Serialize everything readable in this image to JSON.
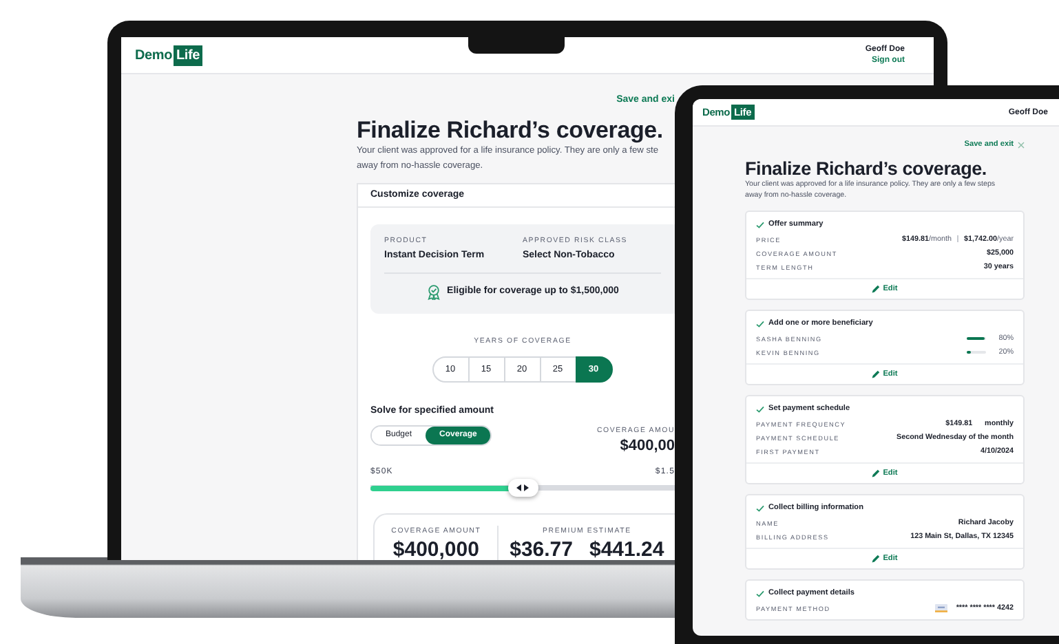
{
  "laptop": {
    "header": {
      "logo": {
        "word": "Demo",
        "badge": "Life"
      },
      "user": "Geoff Doe",
      "sign_out": "Sign out"
    },
    "save_exit": "Save and exi",
    "title": "Finalize Richard’s coverage.",
    "intro_lines": [
      "Your client was approved for a life insurance policy. They are only a few ste",
      "away from no-hassle coverage."
    ],
    "card_title": "Customize coverage",
    "facts": [
      {
        "label": "PRODUCT",
        "value": "Instant Decision Term"
      },
      {
        "label": "APPROVED RISK CLASS",
        "value": "Select Non-Tobacco"
      }
    ],
    "eligibility": "Eligible for coverage up to $1,500,000",
    "years_label": "YEARS OF COVERAGE",
    "years": [
      {
        "label": "10",
        "selected": false
      },
      {
        "label": "15",
        "selected": false
      },
      {
        "label": "20",
        "selected": false
      },
      {
        "label": "25",
        "selected": false
      },
      {
        "label": "30",
        "selected": true
      }
    ],
    "solve_title": "Solve for specified amount",
    "modes": [
      {
        "label": "Budget",
        "selected": false
      },
      {
        "label": "Coverage",
        "selected": true
      }
    ],
    "amount_label": "COVERAGE AMOU",
    "amount_value": "$400,00",
    "slider": {
      "min": "$50K",
      "max": "$1.5",
      "level": 0.5
    },
    "summary": {
      "coverage_label": "COVERAGE AMOUNT",
      "coverage_value": "$400,000",
      "premium_label": "PREMIUM ESTIMATE",
      "premiums": [
        "$36.77",
        "$441.24"
      ]
    }
  },
  "tablet": {
    "header": {
      "logo": {
        "word": "Demo",
        "badge": "Life"
      },
      "user": "Geoff Doe"
    },
    "save_exit": "Save and exit",
    "title": "Finalize Richard’s coverage.",
    "intro_lines": [
      "Your client was approved for a life insurance policy. They are only a few steps",
      "away from no-hassle coverage."
    ],
    "sections": [
      {
        "title": "Offer summary",
        "completed": true,
        "rows": [
          {
            "kind": "text",
            "label": "PRICE",
            "values": [
              {
                "text": "$149.81",
                "unit": "/month"
              },
              {
                "text": "$1,742.00",
                "unit": "/year"
              }
            ]
          },
          {
            "kind": "text",
            "label": "COVERAGE AMOUNT",
            "values": [
              {
                "text": "$25,000"
              }
            ]
          },
          {
            "kind": "text",
            "label": "TERM LENGTH",
            "values": [
              {
                "text": "30 years"
              }
            ]
          }
        ],
        "edit": "Edit"
      },
      {
        "title": "Add one or more beneficiary",
        "completed": true,
        "rows": [
          {
            "kind": "share",
            "label": "SASHA BENNING",
            "level": 0.9,
            "value": "80%"
          },
          {
            "kind": "share",
            "label": "KEVIN BENNING",
            "level": 0.2,
            "value": "20%"
          }
        ],
        "edit": "Edit"
      },
      {
        "title": "Set payment schedule",
        "completed": true,
        "rows": [
          {
            "kind": "text",
            "label": "PAYMENT FREQUENCY",
            "values": [
              {
                "text": "$149.81"
              },
              {
                "text": "monthly"
              }
            ]
          },
          {
            "kind": "text",
            "label": "PAYMENT SCHEDULE",
            "values": [
              {
                "text": "Second Wednesday of the month"
              }
            ]
          },
          {
            "kind": "text",
            "label": "FIRST PAYMENT",
            "values": [
              {
                "text": "4/10/2024"
              }
            ]
          }
        ],
        "edit": "Edit"
      },
      {
        "title": "Collect billing information",
        "completed": true,
        "rows": [
          {
            "kind": "text",
            "label": "NAME",
            "values": [
              {
                "text": "Richard Jacoby"
              }
            ]
          },
          {
            "kind": "text",
            "label": "BILLING ADDRESS",
            "values": [
              {
                "text": "123 Main St, Dallas, TX 12345"
              }
            ]
          }
        ],
        "edit": "Edit"
      },
      {
        "title": "Collect payment details",
        "completed": true,
        "rows": [
          {
            "kind": "card",
            "label": "PAYMENT METHOD",
            "value": "**** **** **** 4242"
          }
        ]
      }
    ]
  }
}
